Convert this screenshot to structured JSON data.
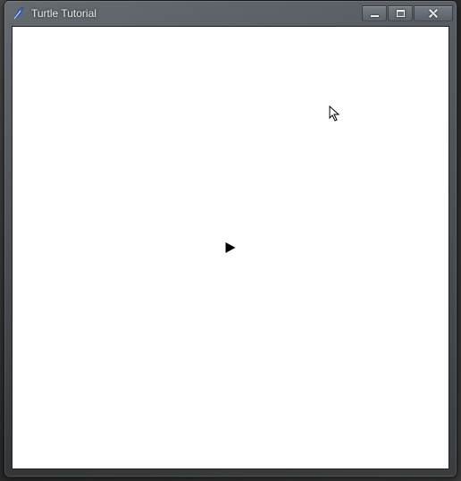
{
  "window": {
    "title": "Turtle Tutorial",
    "icon": "tk-feather-icon"
  },
  "controls": {
    "minimize": "Minimize",
    "maximize": "Maximize",
    "close": "Close"
  },
  "canvas": {
    "background": "#ffffff",
    "turtle_heading_deg": 0
  }
}
